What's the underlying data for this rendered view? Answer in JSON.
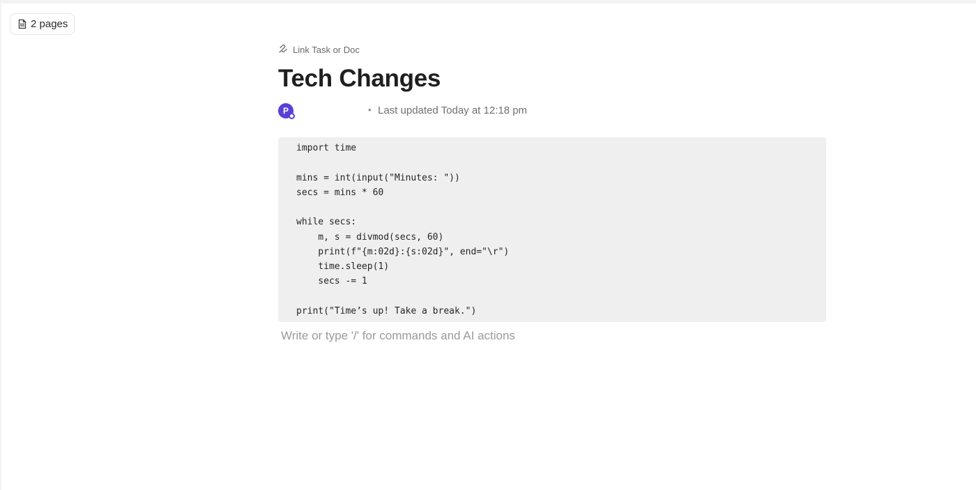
{
  "header": {
    "pages_chip": {
      "label": "2 pages",
      "icon": "document-icon"
    }
  },
  "doc": {
    "link_task": {
      "label": "Link Task or Doc",
      "icon": "link-icon"
    },
    "title": "Tech Changes",
    "meta": {
      "avatar_initial": "P",
      "avatar_color": "#5b3fd6",
      "separator": "•",
      "last_updated": "Last updated Today at 12:18 pm"
    },
    "code_block": {
      "language": "python",
      "lines": [
        "import time",
        "",
        "mins = int(input(\"Minutes: \"))",
        "secs = mins * 60",
        "",
        "while secs:",
        "    m, s = divmod(secs, 60)",
        "    print(f\"{m:02d}:{s:02d}\", end=\"\\r\")",
        "    time.sleep(1)",
        "    secs -= 1",
        "",
        "print(\"Time’s up! Take a break.\")"
      ]
    },
    "editor_placeholder": "Write or type '/' for commands and AI actions"
  }
}
